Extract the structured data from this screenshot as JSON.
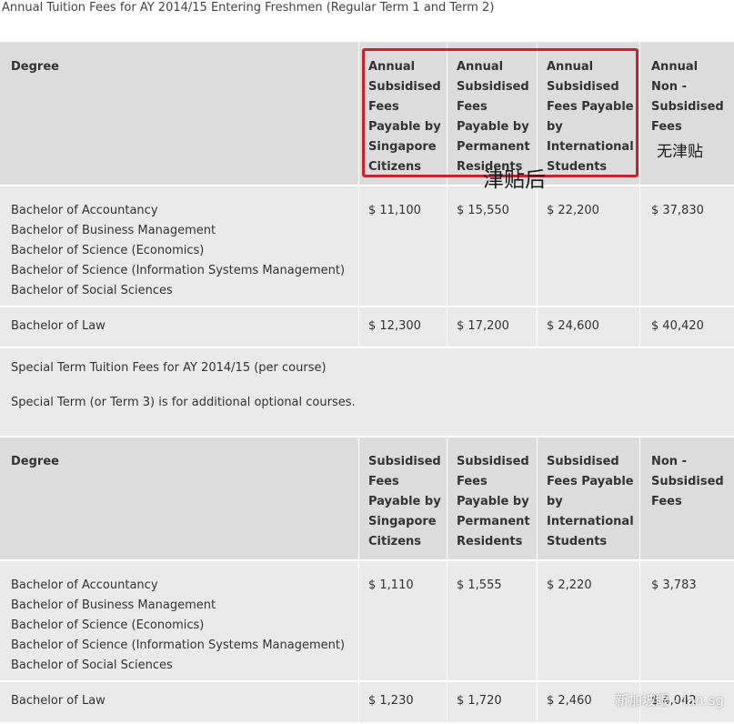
{
  "caption": "Annual Tuition Fees for AY 2014/15 Entering Freshmen (Regular Term 1 and Term 2)",
  "table1": {
    "headers": {
      "degree": "Degree",
      "col1": [
        "Annual",
        "Subsidised",
        "Fees",
        "Payable by",
        "Singapore",
        "Citizens"
      ],
      "col2": [
        "Annual",
        "Subsidised",
        "Fees",
        "Payable by",
        "Permanent",
        "Residents"
      ],
      "col3": [
        "Annual",
        "Subsidised",
        "Fees Payable",
        "by",
        "International",
        "Students"
      ],
      "col4": [
        "Annual",
        "Non -",
        "Subsidised",
        "Fees"
      ]
    },
    "rows": [
      {
        "degrees": [
          "Bachelor of Accountancy",
          "Bachelor of Business Management",
          "Bachelor of Science (Economics)",
          "Bachelor of Science (Information Systems Management)",
          "Bachelor of Social Sciences"
        ],
        "citizens": "$ 11,100",
        "pr": "$ 15,550",
        "international": "$ 22,200",
        "non_subsidised": "$ 37,830"
      },
      {
        "degrees": [
          "Bachelor of Law"
        ],
        "citizens": "$ 12,300",
        "pr": "$ 17,200",
        "international": "$ 24,600",
        "non_subsidised": "$ 40,420"
      }
    ]
  },
  "special_term": {
    "title": "Special Term Tuition Fees for AY 2014/15 (per course)",
    "note": "Special Term (or Term 3) is for additional optional courses."
  },
  "table2": {
    "headers": {
      "degree": "Degree",
      "col1": [
        "Subsidised",
        "Fees",
        "Payable by",
        "Singapore",
        "Citizens"
      ],
      "col2": [
        "Subsidised",
        "Fees",
        "Payable by",
        "Permanent",
        "Residents"
      ],
      "col3": [
        "Subsidised",
        "Fees Payable",
        "by",
        "International",
        "Students"
      ],
      "col4": [
        "Non -",
        "Subsidised",
        "Fees"
      ]
    },
    "rows": [
      {
        "degrees": [
          "Bachelor of Accountancy",
          "Bachelor of Business Management",
          "Bachelor of Science (Economics)",
          "Bachelor of Science (Information Systems Management)",
          "Bachelor of Social Sciences"
        ],
        "citizens": "$ 1,110",
        "pr": "$ 1,555",
        "international": "$ 2,220",
        "non_subsidised": "$ 3,783"
      },
      {
        "degrees": [
          "Bachelor of Law"
        ],
        "citizens": "$ 1,230",
        "pr": "$ 1,720",
        "international": "$ 2,460",
        "non_subsidised": "$ 4,042"
      }
    ]
  },
  "annotations": {
    "after_subsidy": "津贴后",
    "no_subsidy": "无津贴"
  },
  "watermark": "新加坡眼 - lan.sg",
  "colors": {
    "header_bg": "#dcdcdc",
    "row_bg": "#eaeaea",
    "highlight_box": "#c8232c"
  }
}
